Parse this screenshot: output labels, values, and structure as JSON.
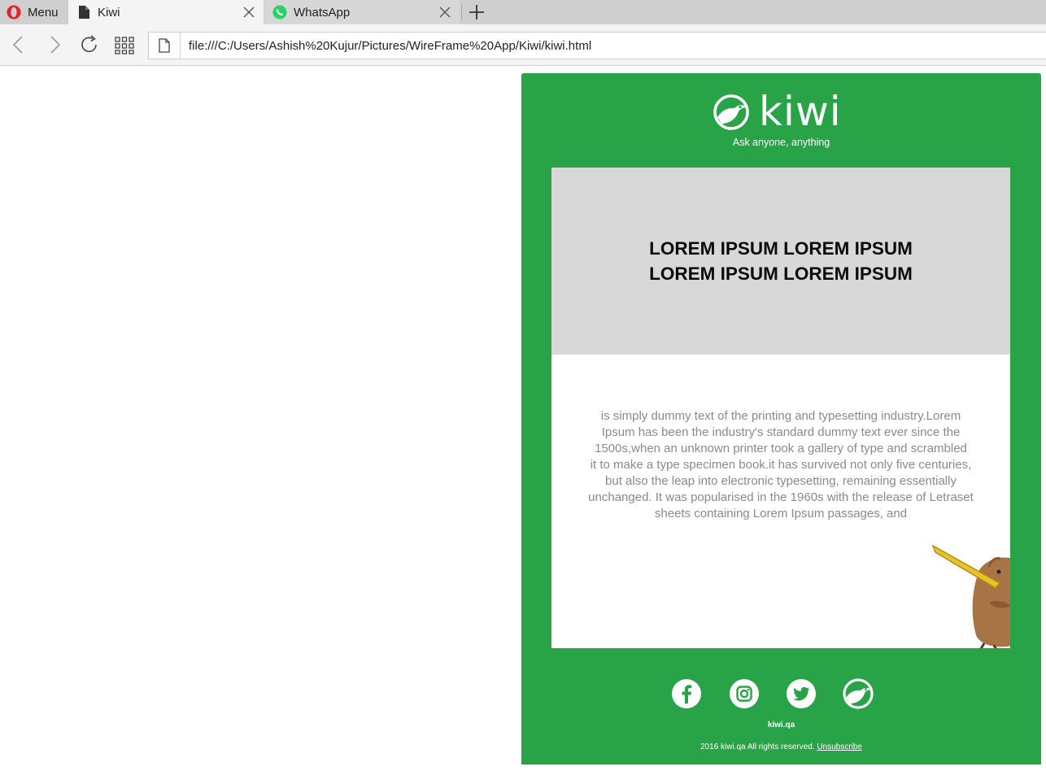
{
  "browser": {
    "menu_label": "Menu",
    "tabs": [
      {
        "title": "Kiwi"
      },
      {
        "title": "WhatsApp"
      }
    ],
    "address": "file:///C:/Users/Ashish%20Kujur/Pictures/WireFrame%20App/Kiwi/kiwi.html"
  },
  "email": {
    "brand_name": "kiwi",
    "tagline": "Ask anyone, anything",
    "hero_title_line1": "LOREM IPSUM LOREM IPSUM",
    "hero_title_line2": "LOREM IPSUM LOREM IPSUM",
    "body_lines": [
      "is simply dummy text of the printing and typesetting industry.Lorem",
      "Ipsum has been the industry's standard dummy text ever since the",
      "1500s,when an unknown printer took a gallery of type and scrambled",
      "it to make a type specimen book.it has survived not only five centuries,",
      "but also the leap into electronic typesetting, remaining essentially",
      "unchanged. It was popularised in the 1960s with the release of Letraset",
      "sheets containing Lorem Ipsum passages, and"
    ],
    "social": [
      "facebook-icon",
      "instagram-icon",
      "twitter-icon",
      "kiwi-icon"
    ],
    "footer_site": "kiwi.qa",
    "footer_copy": "2016 kiwi.qa All rights reserved.",
    "unsubscribe": "Unsubscribe"
  },
  "colors": {
    "brand_green": "#29a347",
    "hero_gray": "#d8d8d8",
    "body_text": "#8a8a8a"
  }
}
